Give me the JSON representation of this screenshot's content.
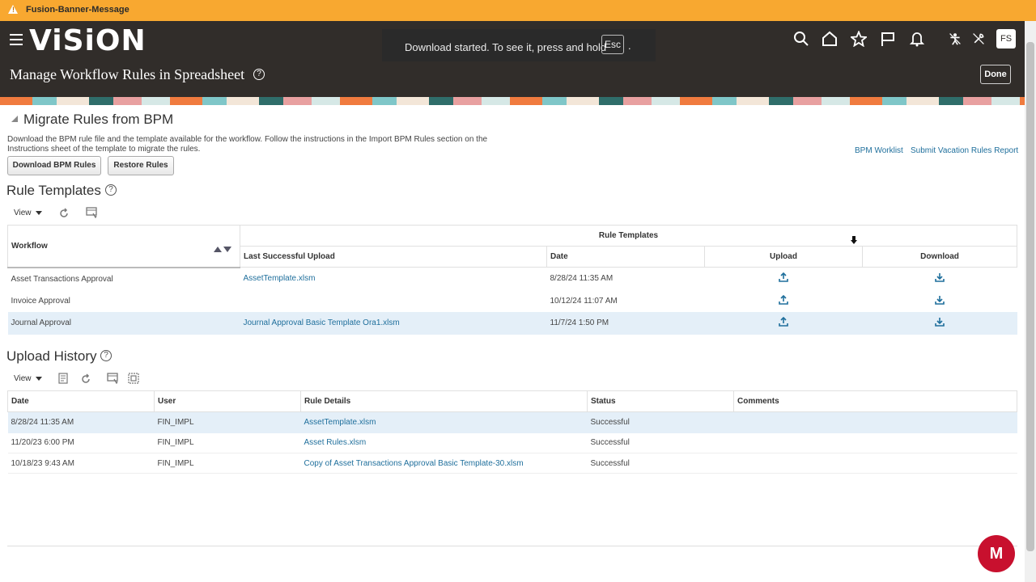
{
  "banner": {
    "message": "Fusion-Banner-Message"
  },
  "header": {
    "logo": "ViSiON",
    "title": "Manage Workflow Rules in Spreadsheet",
    "done_label": "Done",
    "avatar_initials": "FS",
    "toast": {
      "text": "Download started. To see it, press and hold",
      "key": "Esc",
      "suffix": "."
    }
  },
  "migrate": {
    "heading": "Migrate Rules from BPM",
    "description": "Download the BPM rule file and the template available for the workflow. Follow the instructions in the Import BPM Rules section on the Instructions sheet of the template to migrate the rules.",
    "download_button": "Download BPM Rules",
    "restore_button": "Restore Rules",
    "link_worklist": "BPM Worklist",
    "link_vacation": "Submit Vacation Rules Report"
  },
  "rule_templates": {
    "heading": "Rule Templates",
    "view_label": "View",
    "group_header": "Rule Templates",
    "columns": {
      "workflow": "Workflow",
      "last_upload": "Last Successful Upload",
      "date": "Date",
      "upload": "Upload",
      "download": "Download"
    },
    "rows": [
      {
        "workflow": "Asset Transactions Approval",
        "last_upload": "AssetTemplate.xlsm",
        "date": "8/28/24 11:35 AM"
      },
      {
        "workflow": "Invoice Approval",
        "last_upload": "",
        "date": "10/12/24 11:07 AM"
      },
      {
        "workflow": "Journal Approval",
        "last_upload": "Journal Approval Basic Template Ora1.xlsm",
        "date": "11/7/24 1:50 PM"
      }
    ]
  },
  "upload_history": {
    "heading": "Upload History",
    "view_label": "View",
    "columns": {
      "date": "Date",
      "user": "User",
      "rule_details": "Rule Details",
      "status": "Status",
      "comments": "Comments"
    },
    "rows": [
      {
        "date": "8/28/24 11:35 AM",
        "user": "FIN_IMPL",
        "rule_details": "AssetTemplate.xlsm",
        "status": "Successful",
        "comments": ""
      },
      {
        "date": "11/20/23 6:00 PM",
        "user": "FIN_IMPL",
        "rule_details": "Asset Rules.xlsm",
        "status": "Successful",
        "comments": ""
      },
      {
        "date": "10/18/23 9:43 AM",
        "user": "FIN_IMPL",
        "rule_details": "Copy of Asset Transactions Approval Basic Template-30.xlsm",
        "status": "Successful",
        "comments": ""
      }
    ]
  },
  "colors": {
    "banner": "#f8a830",
    "header": "#312d2a",
    "link": "#1f6f9c",
    "selected_row": "#e4eff8"
  }
}
